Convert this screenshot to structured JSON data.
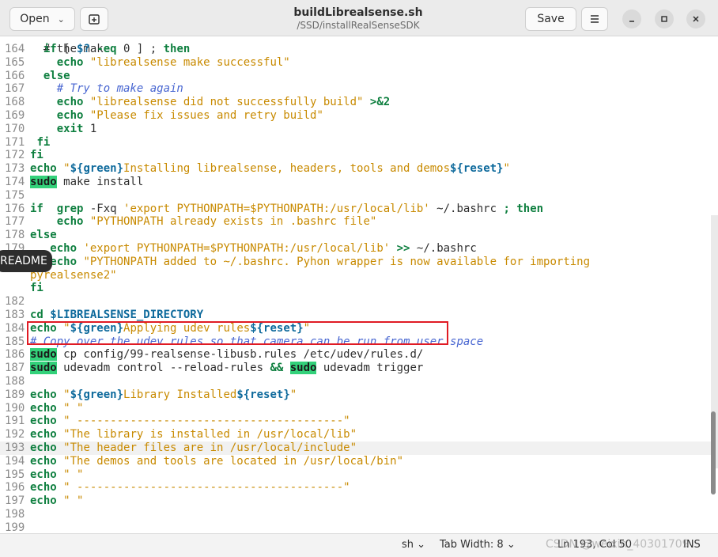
{
  "header": {
    "open_label": "Open",
    "file_name": "buildLibrealsense.sh",
    "file_path": "/SSD/installRealSenseSDK",
    "save_label": "Save"
  },
  "editor": {
    "partial_line": "  # the make",
    "lines": [
      {
        "n": "164",
        "html": "  <span class=\"k\">if</span> [ <span class=\"v\">$?</span> <span class=\"k\">-eq</span> 0 ] ; <span class=\"k\">then</span>"
      },
      {
        "n": "165",
        "html": "    <span class=\"k\">echo</span> <span class=\"s\">\"librealsense make successful\"</span>"
      },
      {
        "n": "166",
        "html": "  <span class=\"k\">else</span>"
      },
      {
        "n": "167",
        "html": "    <span class=\"c\"># Try to make again</span>"
      },
      {
        "n": "168",
        "html": "    <span class=\"k\">echo</span> <span class=\"s\">\"librealsense did not successfully build\"</span> <span class=\"k\">&gt;&amp;2</span>"
      },
      {
        "n": "169",
        "html": "    <span class=\"k\">echo</span> <span class=\"s\">\"Please fix issues and retry build\"</span>"
      },
      {
        "n": "170",
        "html": "    <span class=\"k\">exit</span> 1"
      },
      {
        "n": "171",
        "html": " <span class=\"k\">fi</span>"
      },
      {
        "n": "172",
        "html": "<span class=\"k\">fi</span>"
      },
      {
        "n": "173",
        "html": "<span class=\"k\">echo</span> <span class=\"s\">\"</span><span class=\"v\">${green}</span><span class=\"s\">Installing librealsense, headers, tools and demos</span><span class=\"v\">${reset}</span><span class=\"s\">\"</span>"
      },
      {
        "n": "174",
        "html": "<span class=\"sb\">sudo</span> make install"
      },
      {
        "n": "175",
        "html": ""
      },
      {
        "n": "176",
        "html": "<span class=\"k\">if</span>  <span class=\"k\">grep</span> -Fxq <span class=\"s\">'export PYTHONPATH=$PYTHONPATH:/usr/local/lib'</span> ~/.bashrc <span class=\"k\">;</span> <span class=\"k\">then</span>"
      },
      {
        "n": "177",
        "html": "    <span class=\"k\">echo</span> <span class=\"s\">\"PYTHONPATH already exists in .bashrc file\"</span>"
      },
      {
        "n": "178",
        "html": "<span class=\"k\">else</span>"
      },
      {
        "n": "179",
        "html": "   <span class=\"k\">echo</span> <span class=\"s\">'export PYTHONPATH=$PYTHONPATH:/usr/local/lib'</span> <span class=\"k\">&gt;&gt;</span> ~/.bashrc"
      },
      {
        "n": "180",
        "html": "   <span class=\"k\">echo</span> <span class=\"s\">\"PYTHONPATH added to ~/.bashrc. Pyhon wrapper is now available for importing</span>"
      },
      {
        "n": "",
        "html": "<span class=\"s\">pyrealsense2\"</span>"
      },
      {
        "n": "",
        "html": "<span class=\"k\">fi</span>"
      },
      {
        "n": "182",
        "html": ""
      },
      {
        "n": "183",
        "html": "<span class=\"k\">cd</span> <span class=\"v\">$LIBREALSENSE_DIRECTORY</span>"
      },
      {
        "n": "184",
        "html": "<span class=\"k\">echo</span> <span class=\"s\">\"</span><span class=\"v\">${green}</span><span class=\"s\">Applying udev rules</span><span class=\"v\">${reset}</span><span class=\"s\">\"</span>"
      },
      {
        "n": "185",
        "html": "<span class=\"c\"># Copy over the udev rules so that camera can be run from user space</span>"
      },
      {
        "n": "186",
        "html": "<span class=\"sb\">sudo</span> cp config/99-realsense-libusb.rules /etc/udev/rules.d/"
      },
      {
        "n": "187",
        "html": "<span class=\"sb\">sudo</span> udevadm control --reload-rules <span class=\"k\">&amp;&amp;</span> <span class=\"sb\">sudo</span> udevadm trigger"
      },
      {
        "n": "188",
        "html": ""
      },
      {
        "n": "189",
        "html": "<span class=\"k\">echo</span> <span class=\"s\">\"</span><span class=\"v\">${green}</span><span class=\"s\">Library Installed</span><span class=\"v\">${reset}</span><span class=\"s\">\"</span>"
      },
      {
        "n": "190",
        "html": "<span class=\"k\">echo</span> <span class=\"s\">\" \"</span>"
      },
      {
        "n": "191",
        "html": "<span class=\"k\">echo</span> <span class=\"s\">\" ----------------------------------------\"</span>"
      },
      {
        "n": "192",
        "html": "<span class=\"k\">echo</span> <span class=\"s\">\"The library is installed in /usr/local/lib\"</span>"
      },
      {
        "n": "193",
        "html": "<span class=\"k\">echo</span> <span class=\"s\">\"The header files are in /usr/local/include\"</span>",
        "current": true
      },
      {
        "n": "194",
        "html": "<span class=\"k\">echo</span> <span class=\"s\">\"The demos and tools are located in /usr/local/bin\"</span>"
      },
      {
        "n": "195",
        "html": "<span class=\"k\">echo</span> <span class=\"s\">\" \"</span>"
      },
      {
        "n": "196",
        "html": "<span class=\"k\">echo</span> <span class=\"s\">\" ----------------------------------------\"</span>"
      },
      {
        "n": "197",
        "html": "<span class=\"k\">echo</span> <span class=\"s\">\" \"</span>"
      },
      {
        "n": "198",
        "html": ""
      },
      {
        "n": "199",
        "html": ""
      }
    ]
  },
  "tooltip": "README",
  "status": {
    "language": "sh",
    "tab_width": "Tab Width: 8",
    "position": "Ln 193, Col 50",
    "mode": "INS"
  },
  "watermark": "CSDN @weixin_40301709"
}
